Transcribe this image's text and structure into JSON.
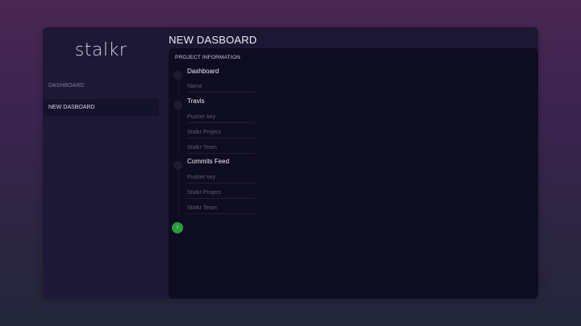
{
  "app": {
    "logo_text": "stalkr"
  },
  "sidebar": {
    "items": [
      {
        "label": "DASHBOARD",
        "active": false
      },
      {
        "label": "NEW DASBOARD",
        "active": true
      }
    ]
  },
  "page": {
    "title": "NEW DASBOARD"
  },
  "form": {
    "section_label": "PROJECT INFORMATION",
    "groups": [
      {
        "title": "Dashboard",
        "fields": [
          {
            "placeholder": "Name",
            "value": ""
          }
        ]
      },
      {
        "title": "Travis",
        "fields": [
          {
            "placeholder": "Pusher key",
            "value": ""
          },
          {
            "placeholder": "Stalkr Project",
            "value": ""
          },
          {
            "placeholder": "Stalkr Team",
            "value": ""
          }
        ]
      },
      {
        "title": "Commits Feed",
        "fields": [
          {
            "placeholder": "Pusher key",
            "value": ""
          },
          {
            "placeholder": "Stalkr Project",
            "value": ""
          },
          {
            "placeholder": "Stalkr Team",
            "value": ""
          }
        ]
      }
    ],
    "submit": {
      "icon": "chevron-right-icon",
      "glyph": "›",
      "color": "#2c9b3c"
    }
  }
}
